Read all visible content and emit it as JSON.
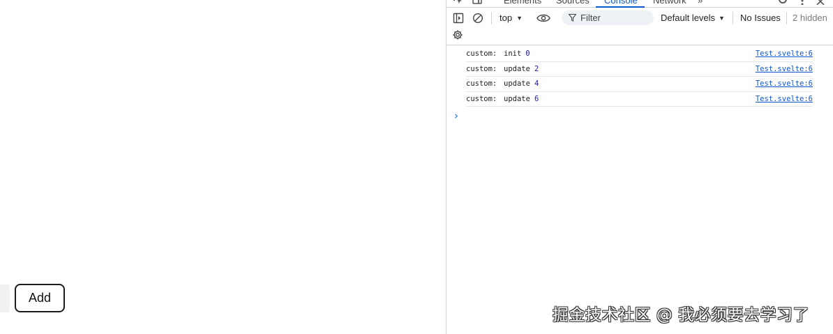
{
  "page": {
    "add_button_label": "Add"
  },
  "devtools": {
    "tabs": [
      "Elements",
      "Sources",
      "Console",
      "Network",
      "»"
    ],
    "active_tab": "Console",
    "toolbar": {
      "context": "top",
      "filter_placeholder": "Filter",
      "levels": "Default levels",
      "issues": "No Issues",
      "hidden": "2 hidden"
    },
    "icons": {
      "sidebar": "sidebar-toggle-icon",
      "clear": "clear-console-icon",
      "eye": "live-expression-eye-icon",
      "filter": "filter-funnel-icon",
      "settings": "gear-icon"
    },
    "console_lines": [
      {
        "label": "custom:",
        "word": "init",
        "num": "0",
        "source": "Test.svelte:6"
      },
      {
        "label": "custom:",
        "word": "update",
        "num": "2",
        "source": "Test.svelte:6"
      },
      {
        "label": "custom:",
        "word": "update",
        "num": "4",
        "source": "Test.svelte:6"
      },
      {
        "label": "custom:",
        "word": "update",
        "num": "6",
        "source": "Test.svelte:6"
      }
    ],
    "prompt": "›"
  },
  "watermark": "掘金技术社区 @ 我必须要去学习了",
  "colors": {
    "accent": "#0b57d0",
    "number": "#1a1aa6",
    "link": "#1155cc",
    "border": "#d0d3d8"
  }
}
